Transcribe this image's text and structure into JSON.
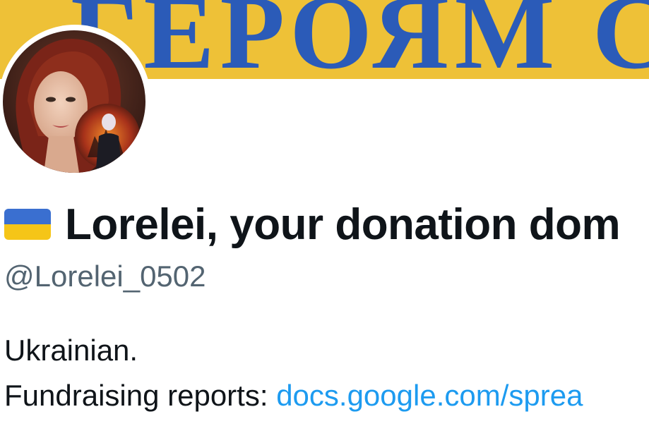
{
  "profile": {
    "banner_text": "ГЕРОЯМ СЛ",
    "flag_colors": {
      "top": "#3a6fd0",
      "bottom": "#f5c518"
    },
    "display_name": "Lorelei, your donation dom",
    "handle": "@Lorelei_0502",
    "bio": {
      "line1": "Ukrainian.",
      "line2_prefix": "Fundraising reports: ",
      "line2_link": "docs.google.com/sprea"
    }
  },
  "colors": {
    "banner_bg": "#f1c43a",
    "banner_text": "#2b5bb8",
    "name": "#0f1419",
    "handle": "#536471",
    "link": "#1d9bf0"
  }
}
